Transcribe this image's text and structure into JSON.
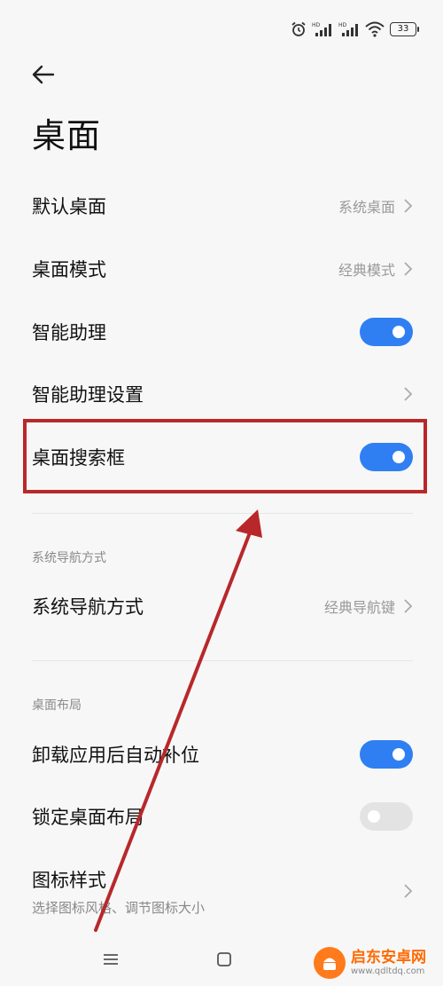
{
  "status": {
    "battery": "33"
  },
  "page_title": "桌面",
  "rows": {
    "default_desktop": {
      "label": "默认桌面",
      "value": "系统桌面"
    },
    "desktop_mode": {
      "label": "桌面模式",
      "value": "经典模式"
    },
    "smart_assistant": {
      "label": "智能助理",
      "toggle": "on"
    },
    "smart_assistant_settings": {
      "label": "智能助理设置"
    },
    "desktop_search_box": {
      "label": "桌面搜索框",
      "toggle": "on"
    },
    "nav_mode": {
      "label": "系统导航方式",
      "value": "经典导航键"
    },
    "auto_fill": {
      "label": "卸载应用后自动补位",
      "toggle": "on"
    },
    "lock_layout": {
      "label": "锁定桌面布局",
      "toggle": "off"
    },
    "icon_style": {
      "label": "图标样式",
      "sub": "选择图标风格、调节图标大小"
    }
  },
  "sections": {
    "nav": "系统导航方式",
    "layout": "桌面布局"
  },
  "watermark": {
    "name": "启东安卓网",
    "url": "www.qdltdq.com"
  },
  "colors": {
    "accent": "#2f7ff2",
    "highlight": "#b8282a",
    "watermark": "#ff6a00"
  }
}
